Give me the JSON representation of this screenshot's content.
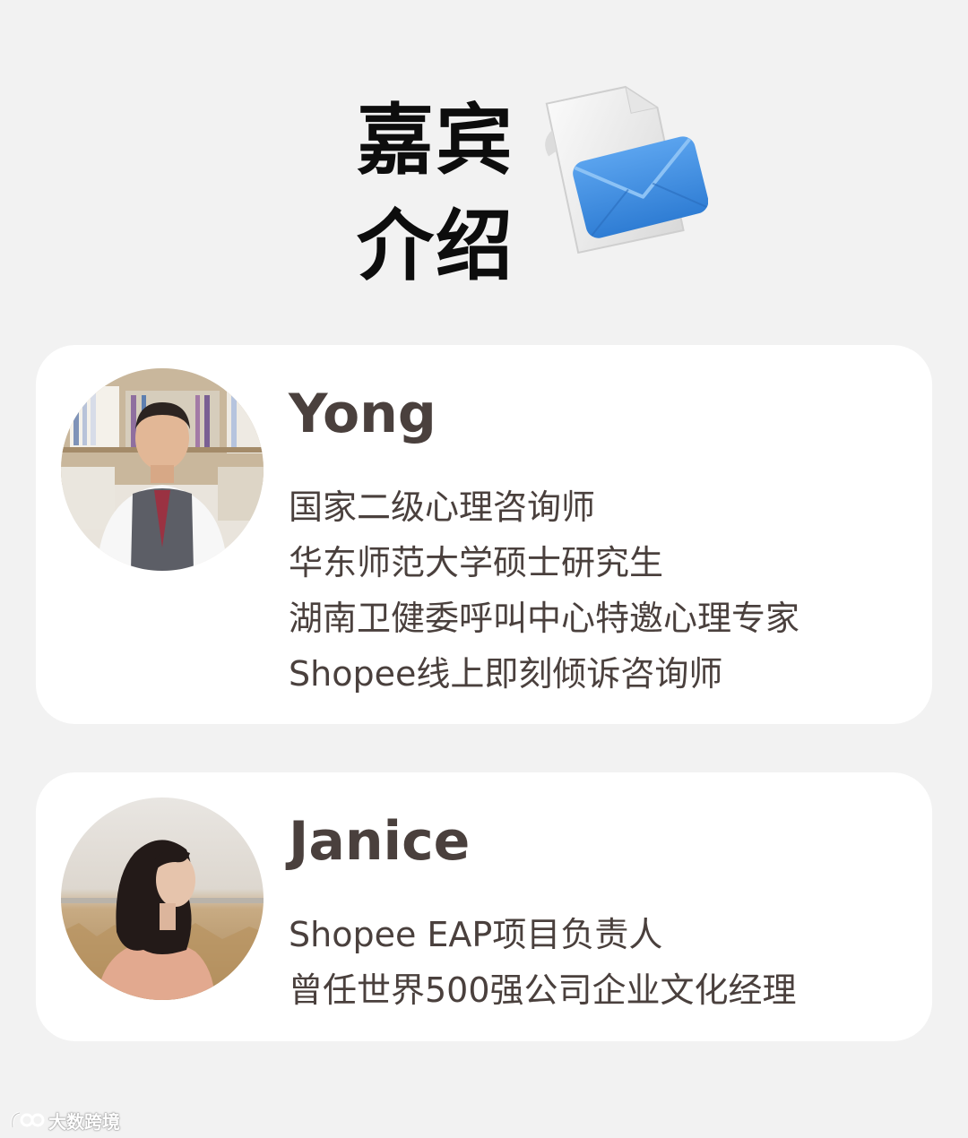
{
  "header": {
    "title_line1": "嘉宾",
    "title_line2": "介绍",
    "icon": "envelope-document-icon"
  },
  "guests": [
    {
      "name": "Yong",
      "avatar": "guest-photo-man",
      "lines": [
        "国家二级心理咨询师",
        "华东师范大学硕士研究生",
        "湖南卫健委呼叫中心特邀心理专家",
        "Shopee线上即刻倾诉咨询师"
      ]
    },
    {
      "name": "Janice",
      "avatar": "guest-photo-woman",
      "lines": [
        "Shopee EAP项目负责人",
        "曾任世界500强公司企业文化经理"
      ]
    }
  ],
  "watermark": {
    "text": "大数跨境",
    "icon": "brand-logo-icon"
  },
  "colors": {
    "background": "#f2f2f2",
    "card": "#ffffff",
    "text": "#4a403d",
    "title": "#0d0d0d",
    "envelope": "#3f8ee0"
  }
}
